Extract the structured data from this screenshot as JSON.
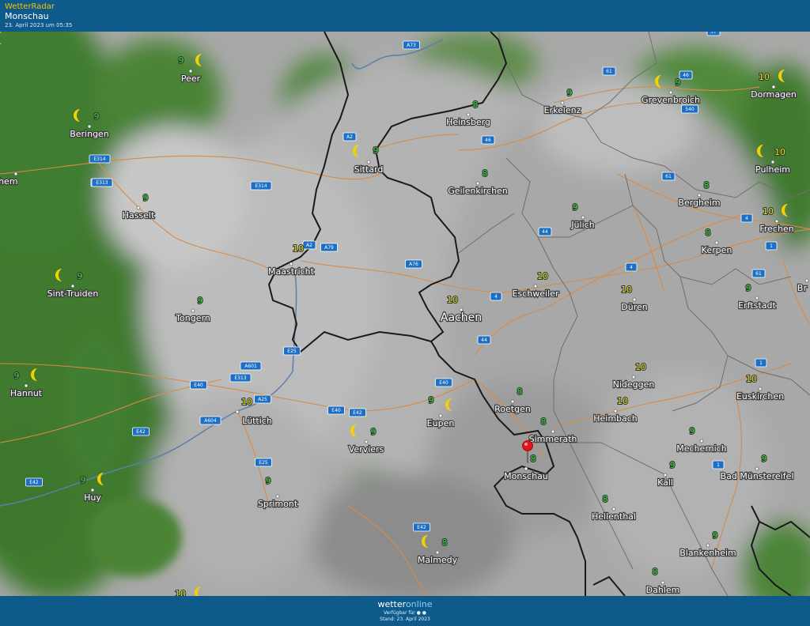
{
  "header": {
    "app_title": "WetterRadar",
    "location": "Monschau",
    "timestamp": "23. April 2023 um 05:35"
  },
  "footer": {
    "brand_prefix": "wetter",
    "brand_suffix": "online",
    "available": "Verfügbar für",
    "stand": "Stand: 23. April 2023"
  },
  "colors": {
    "header_bg": "#0e5a8a",
    "brand_yellow": "#f5c400",
    "temp_green": "#39d83b",
    "temp_yellow": "#e3e61a",
    "road_sign_blue": "#1c6fc4",
    "road_orange": "#d98a45",
    "border_black": "#1a1a1a",
    "pin_red": "#e1141b",
    "moon_yellow": "#f6d100"
  },
  "cities": [
    {
      "name": "Peer",
      "temp": "9",
      "moon": "yes"
    },
    {
      "name": "Beringen",
      "temp": "9",
      "moon": "yes"
    },
    {
      "name": "-Zichem",
      "temp": "",
      "moon": "no"
    },
    {
      "name": "Hasselt",
      "temp": "9",
      "moon": "no"
    },
    {
      "name": "Sint-Truiden",
      "temp": "9",
      "moon": "yes"
    },
    {
      "name": "Tongern",
      "temp": "9",
      "moon": "no"
    },
    {
      "name": "Hannut",
      "temp": "9",
      "moon": "yes"
    },
    {
      "name": "Huy",
      "temp": "9",
      "moon": "yes"
    },
    {
      "name": "Sittard",
      "temp": "9",
      "moon": "yes"
    },
    {
      "name": "Maastricht",
      "temp": "10",
      "moon": "no"
    },
    {
      "name": "Lüttich",
      "temp": "10",
      "moon": "no"
    },
    {
      "name": "Sprimont",
      "temp": "9",
      "moon": "no"
    },
    {
      "name": "Verviers",
      "temp": "9",
      "moon": "yes"
    },
    {
      "name": "Eupen",
      "temp": "9",
      "moon": "yes"
    },
    {
      "name": "Malmedy",
      "temp": "8",
      "moon": "yes"
    },
    {
      "name": "Heinsberg",
      "temp": "8",
      "moon": "no"
    },
    {
      "name": "Geilenkirchen",
      "temp": "8",
      "moon": "no"
    },
    {
      "name": "Aachen",
      "temp": "10",
      "moon": "no"
    },
    {
      "name": "Roetgen",
      "temp": "8",
      "moon": "no"
    },
    {
      "name": "Simmerath",
      "temp": "8",
      "moon": "no"
    },
    {
      "name": "Monschau",
      "temp": "8",
      "moon": "no"
    },
    {
      "name": "Erkelenz",
      "temp": "9",
      "moon": "no"
    },
    {
      "name": "Jülich",
      "temp": "9",
      "moon": "no"
    },
    {
      "name": "Eschweiler",
      "temp": "10",
      "moon": "no"
    },
    {
      "name": "Düren",
      "temp": "10",
      "moon": "no"
    },
    {
      "name": "Nideggen",
      "temp": "10",
      "moon": "no"
    },
    {
      "name": "Heimbach",
      "temp": "10",
      "moon": "no"
    },
    {
      "name": "Hellenthal",
      "temp": "8",
      "moon": "no"
    },
    {
      "name": "Grevenbroich",
      "temp": "9",
      "moon": "yes"
    },
    {
      "name": "Bergheim",
      "temp": "8",
      "moon": "no"
    },
    {
      "name": "Kerpen",
      "temp": "8",
      "moon": "no"
    },
    {
      "name": "Erftstadt",
      "temp": "9",
      "moon": "no"
    },
    {
      "name": "Euskirchen",
      "temp": "10",
      "moon": "no"
    },
    {
      "name": "Mechernich",
      "temp": "9",
      "moon": "no"
    },
    {
      "name": "Kall",
      "temp": "9",
      "moon": "no"
    },
    {
      "name": "Bad Münstereifel",
      "temp": "9",
      "moon": "no"
    },
    {
      "name": "Blankenheim",
      "temp": "9",
      "moon": "no"
    },
    {
      "name": "Dahlem",
      "temp": "8",
      "moon": "no"
    },
    {
      "name": "Dormagen",
      "temp": "10",
      "moon": "yes"
    },
    {
      "name": "Pulheim",
      "temp": "10",
      "moon": "yes"
    },
    {
      "name": "Frechen",
      "temp": "10",
      "moon": "yes"
    },
    {
      "name": "Br",
      "temp": "",
      "moon": "no"
    },
    {
      "name": "",
      "temp": "10",
      "moon": "yes"
    }
  ],
  "road_signs": [
    "A73",
    "A2",
    "A2",
    "A79",
    "A76",
    "E314",
    "E313",
    "E314",
    "E313",
    "E25",
    "A601",
    "E313",
    "E40",
    "A25",
    "A604",
    "E42",
    "E40",
    "E42",
    "E40",
    "E25",
    "E42",
    "E42",
    "46",
    "61",
    "46",
    "540",
    "61",
    "44",
    "4",
    "4",
    "44",
    "4",
    "1",
    "61",
    "1",
    "1",
    "57"
  ]
}
